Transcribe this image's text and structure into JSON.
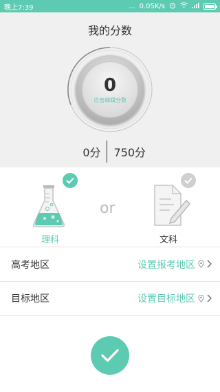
{
  "status_bar": {
    "time": "晚上7:39",
    "network_speed": "0.05K/s",
    "signal_dots": "..."
  },
  "header": {
    "title": "我的分数"
  },
  "score_gauge": {
    "score": "0",
    "edit_label": "点击编辑分数",
    "fill_fraction": 0
  },
  "range": {
    "min": "0分",
    "max": "750分"
  },
  "subjects": {
    "science": {
      "label": "理科",
      "selected": true
    },
    "or_text": "or",
    "arts": {
      "label": "文科",
      "selected": false
    }
  },
  "settings": {
    "exam_region": {
      "label": "高考地区",
      "value": "设置报考地区"
    },
    "target_region": {
      "label": "目标地区",
      "value": "设置目标地区"
    }
  },
  "colors": {
    "accent": "#5dcbb2",
    "top_bg": "#f0f0f0",
    "inactive_check": "#cfcfcf"
  }
}
